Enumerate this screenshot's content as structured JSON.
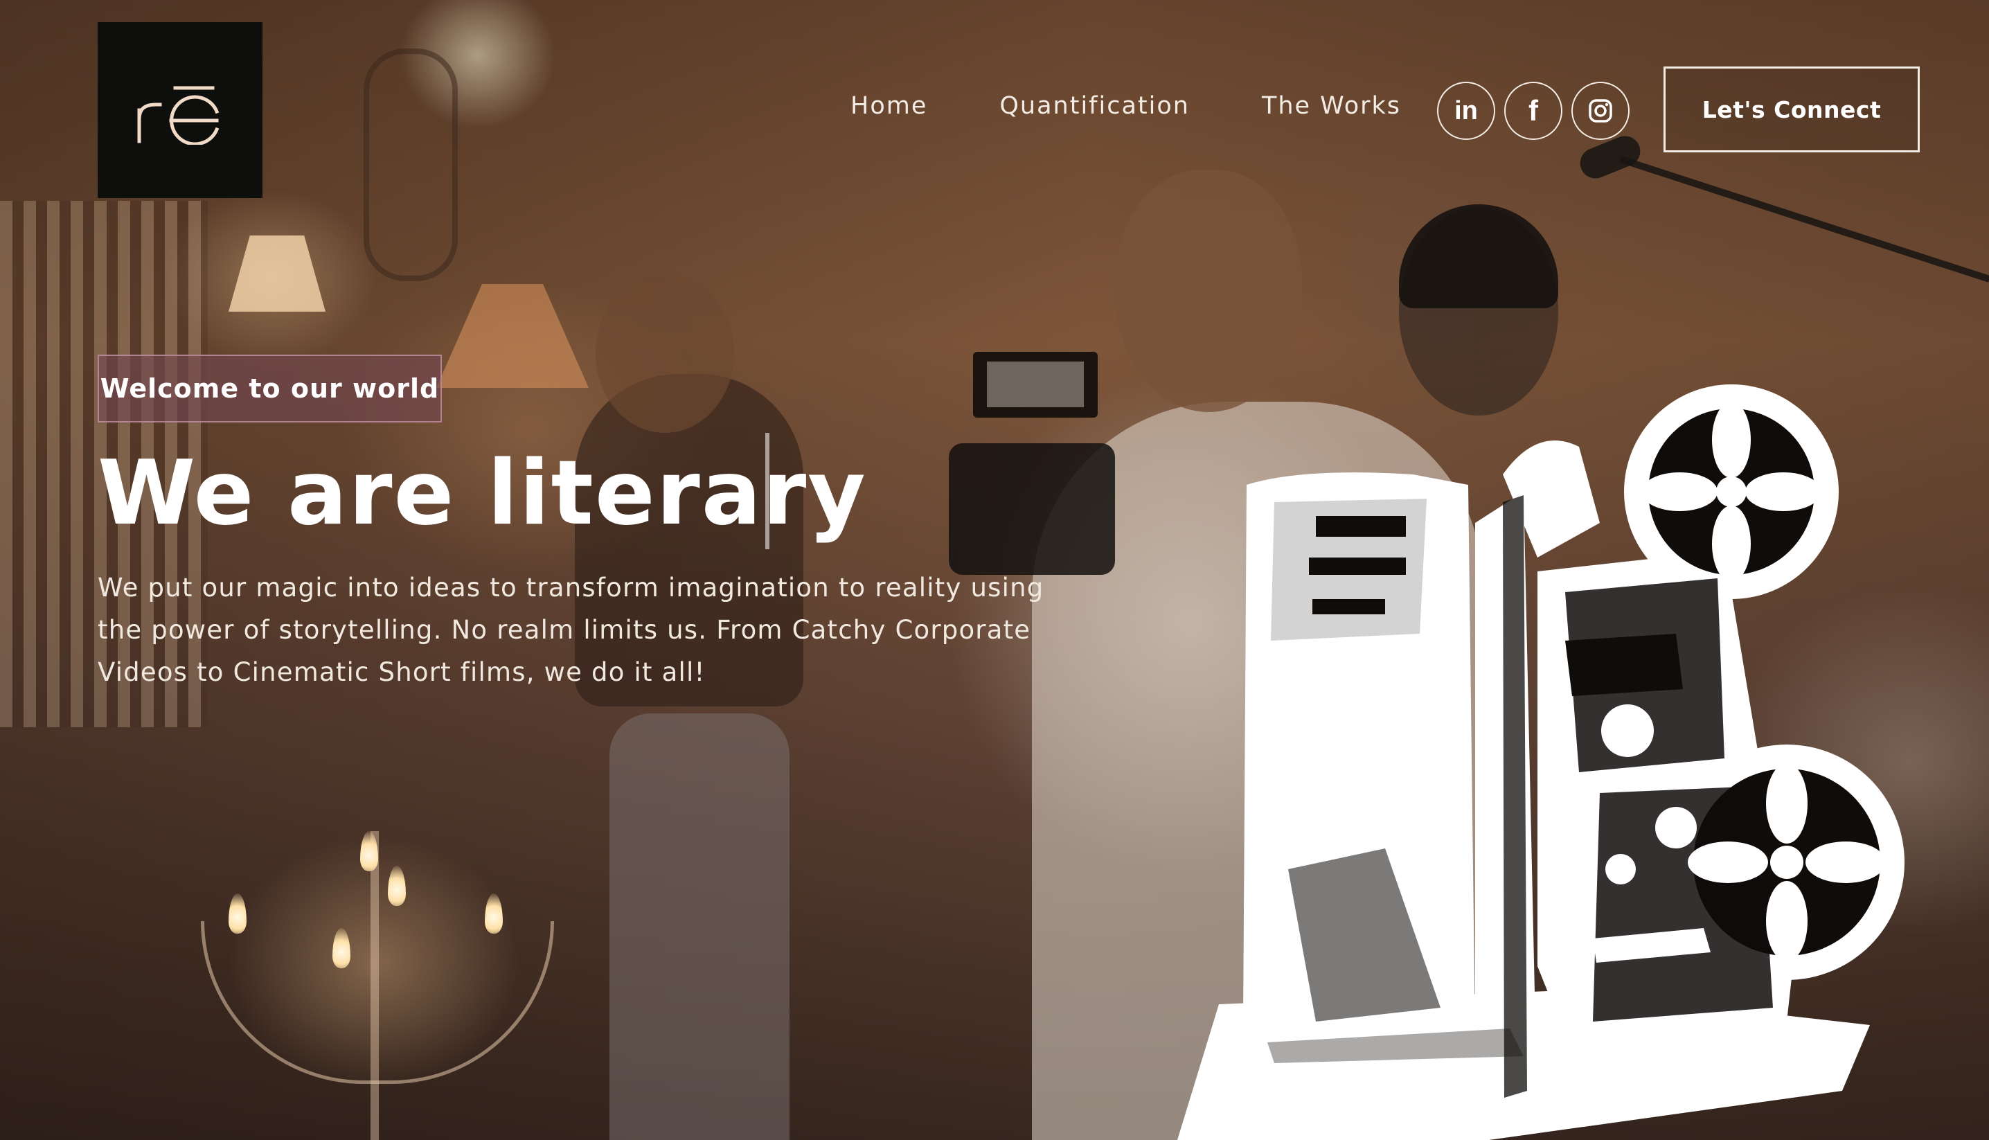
{
  "logo": {
    "icon": "rc-monogram-logo",
    "colors": {
      "background": "#0e0f0d",
      "mark": "#f1dbc8"
    }
  },
  "nav": {
    "links": [
      {
        "label": "Home"
      },
      {
        "label": "Quantification"
      },
      {
        "label": "The Works"
      }
    ]
  },
  "social": {
    "items": [
      {
        "icon": "linkedin-icon",
        "label": "in"
      },
      {
        "icon": "facebook-icon",
        "label": "f"
      },
      {
        "icon": "instagram-icon",
        "label": ""
      }
    ]
  },
  "cta": {
    "label": "Let's Connect"
  },
  "hero": {
    "tag": "Welcome to our world",
    "title": "We are literary",
    "body": "We put our magic into ideas to transform imagination to reality using the power of storytelling. No realm limits us. From Catchy Corporate Videos to Cinematic Short films, we do it all!",
    "illustration": "film-projector-illustration",
    "background": "film-crew-photo"
  },
  "colors": {
    "text": "#ffffff",
    "nav_text": "#f3ece4",
    "tag_background": "#73464f",
    "tag_border": "#cd9baf"
  }
}
